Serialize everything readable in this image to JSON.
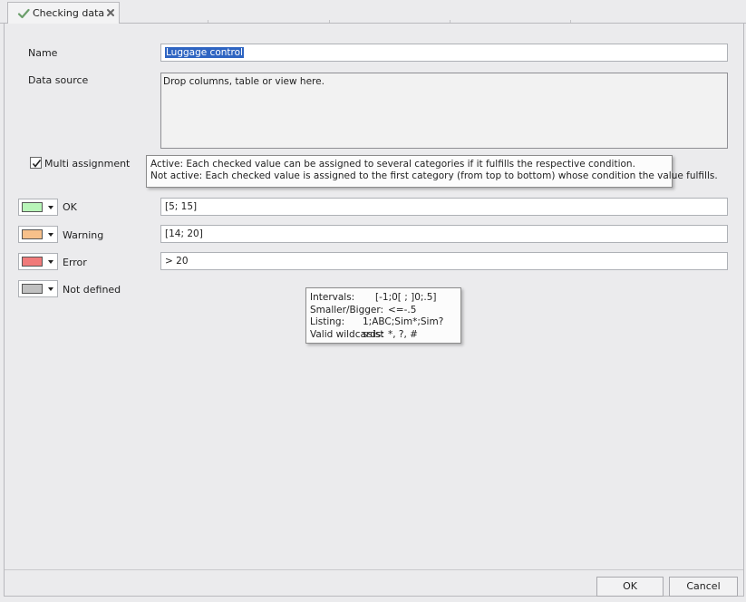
{
  "tab": {
    "label": "Checking data",
    "icon": "checkmark-icon",
    "close_icon": "close-icon"
  },
  "form": {
    "name_label": "Name",
    "name_value": "Luggage control",
    "datasource_label": "Data source",
    "datasource_placeholder": "Drop columns, table or view here.",
    "multi_label": "Multi assignment",
    "multi_checked": true,
    "multi_tooltip": {
      "line1": "Active: Each checked value can be assigned to several categories if it fulfills the respective condition.",
      "line2": "Not active: Each checked value is assigned to the first category (from top to bottom) whose condition the value fulfills."
    }
  },
  "categories": [
    {
      "label": "OK",
      "color": "#b8f5b8",
      "value": "[5; 15]"
    },
    {
      "label": "Warning",
      "color": "#f7c08a",
      "value": "[14; 20]"
    },
    {
      "label": "Error",
      "color": "#f07a7a",
      "value": "> 20"
    },
    {
      "label": "Not defined",
      "color": "#c0c0c0",
      "value": ""
    }
  ],
  "syntax_tooltip": {
    "intervals_key": "Intervals:",
    "intervals_val": "[-1;0[ ; ]0;.5]",
    "smaller_key": "Smaller/Bigger:",
    "smaller_val": "<=-.5",
    "listing_key": "Listing:",
    "listing_val": "1;ABC;Sim*;Sim?ssist",
    "wildcards_key": "Valid wildcards:",
    "wildcards_val": "*, ?, #"
  },
  "buttons": {
    "ok": "OK",
    "cancel": "Cancel"
  }
}
